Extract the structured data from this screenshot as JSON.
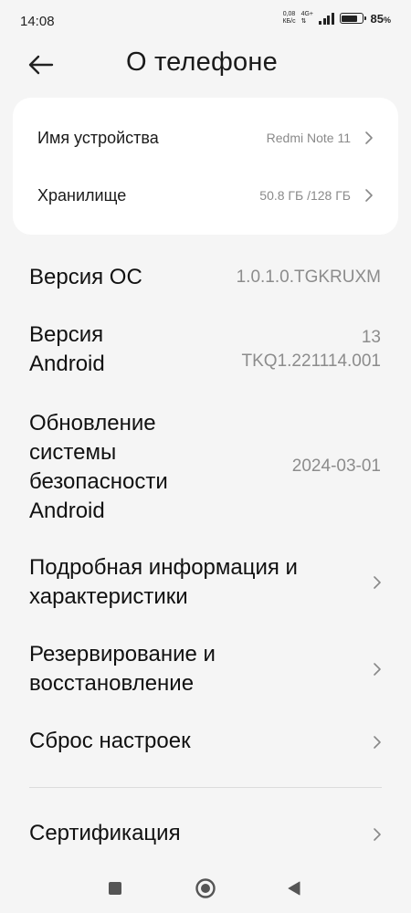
{
  "status_bar": {
    "time": "14:08",
    "net_speed_value": "0,08",
    "net_speed_unit": "КБ/с",
    "net_type": "4G+",
    "battery_percent": "85",
    "battery_percent_sign": "%",
    "battery_level": 0.85
  },
  "header": {
    "title": "О телефоне"
  },
  "card": {
    "device_name_label": "Имя устройства",
    "device_name_value": "Redmi Note 11",
    "storage_label": "Хранилище",
    "storage_value": "50.8 ГБ /128 ГБ"
  },
  "rows": {
    "os_version_label": "Версия ОС",
    "os_version_value": "1.0.1.0.TGKRUXM",
    "android_version_label_1": "Версия",
    "android_version_label_2": "Android",
    "android_version_value_1": "13",
    "android_version_value_2": "TKQ1.221114.001",
    "security_update_label_1": "Обновление",
    "security_update_label_2": "системы",
    "security_update_label_3": "безопасности",
    "security_update_label_4": "Android",
    "security_update_value": "2024-03-01",
    "detailed_info_label_1": "Подробная информация и",
    "detailed_info_label_2": "характеристики",
    "backup_label_1": "Резервирование и",
    "backup_label_2": "восстановление",
    "reset_label": "Сброс настроек",
    "certification_label": "Сертификация"
  },
  "icons": {
    "back": "arrow-left-icon",
    "chevron": "chevron-right-icon",
    "nav_recents": "square-icon",
    "nav_home": "circle-icon",
    "nav_back": "triangle-icon"
  }
}
